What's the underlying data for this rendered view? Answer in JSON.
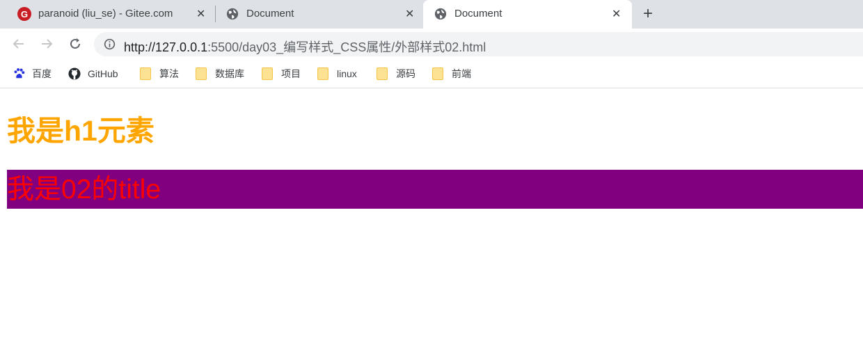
{
  "tabs": [
    {
      "title": "paranoid (liu_se) - Gitee.com",
      "icon": "gitee-icon",
      "icon_glyph": "G"
    },
    {
      "title": "Document",
      "icon": "globe-icon"
    },
    {
      "title": "Document",
      "icon": "globe-icon",
      "active": true
    }
  ],
  "close_glyph": "✕",
  "new_tab_glyph": "+",
  "toolbar": {
    "url_host": "http://127.0.0.1",
    "url_path": ":5500/day03_编写样式_CSS属性/外部样式02.html"
  },
  "bookmarks": [
    {
      "label": "百度",
      "icon": "baidu-icon"
    },
    {
      "label": "GitHub",
      "icon": "github-icon"
    },
    {
      "label": "算法",
      "icon": "folder-icon"
    },
    {
      "label": "数据库",
      "icon": "folder-icon"
    },
    {
      "label": "项目",
      "icon": "folder-icon"
    },
    {
      "label": "linux",
      "icon": "folder-icon"
    },
    {
      "label": "源码",
      "icon": "folder-icon"
    },
    {
      "label": "前端",
      "icon": "folder-icon"
    }
  ],
  "page": {
    "h1": "我是h1元素",
    "title": "我是02的title",
    "h1_color": "#ffa500",
    "title_color": "#ff0000",
    "title_bg": "#800080"
  }
}
